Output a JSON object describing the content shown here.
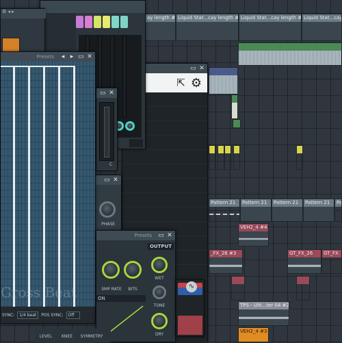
{
  "playlist": {
    "top_clips": [
      "ay length #13",
      "Liquid Stat...cay length #14",
      "Liquid Stat...cay length #14",
      "Liquid Stat...cay length #14"
    ],
    "pattern_clips": [
      "Pattern 21",
      "Pattern 21",
      "Pattern 21",
      "Pattern 21",
      "Pattern 21"
    ],
    "veh_clip_1": "VEH2_4 #4",
    "fx_clip_1": "_FX_26 #3",
    "fx_clip_2": "GT_FX_26",
    "fx_clip_3": "GT_FX",
    "tps_clip": "TPS - Ulti...ter 04 #2",
    "veh_clip_2": "VEH2_4 #3"
  },
  "fpc_window": {
    "pad_colors": [
      "#c77bd6",
      "#d77fd0",
      "#d6e46a",
      "#e7eb70",
      "#7fd8c9",
      "#7fd2c4"
    ]
  },
  "gross_beat": {
    "presets_label": "Presets",
    "watermark": "Gross Beat",
    "time_sync_label": "SYNC:",
    "time_sync_value": "1/4 beat",
    "pos_sync_label": "POS SYNC:",
    "pos_sync_value": "Off"
  },
  "browser_panel": {
    "fx_label": "C"
  },
  "phase_panel": {
    "phase_label": "PHASE"
  },
  "effect_plugin": {
    "presets_label": "Presets",
    "output_label": "OUTPUT",
    "knob_labels": [
      "SMP RATE",
      "BITS",
      "WET",
      "TONE",
      "DRY"
    ],
    "bottom_labels": [
      "LEVEL",
      "KNEE",
      "SYMMETRY"
    ],
    "field_text": "ON"
  },
  "colors": {
    "accent_green": "#a8d83a",
    "orange": "#e08c22"
  }
}
